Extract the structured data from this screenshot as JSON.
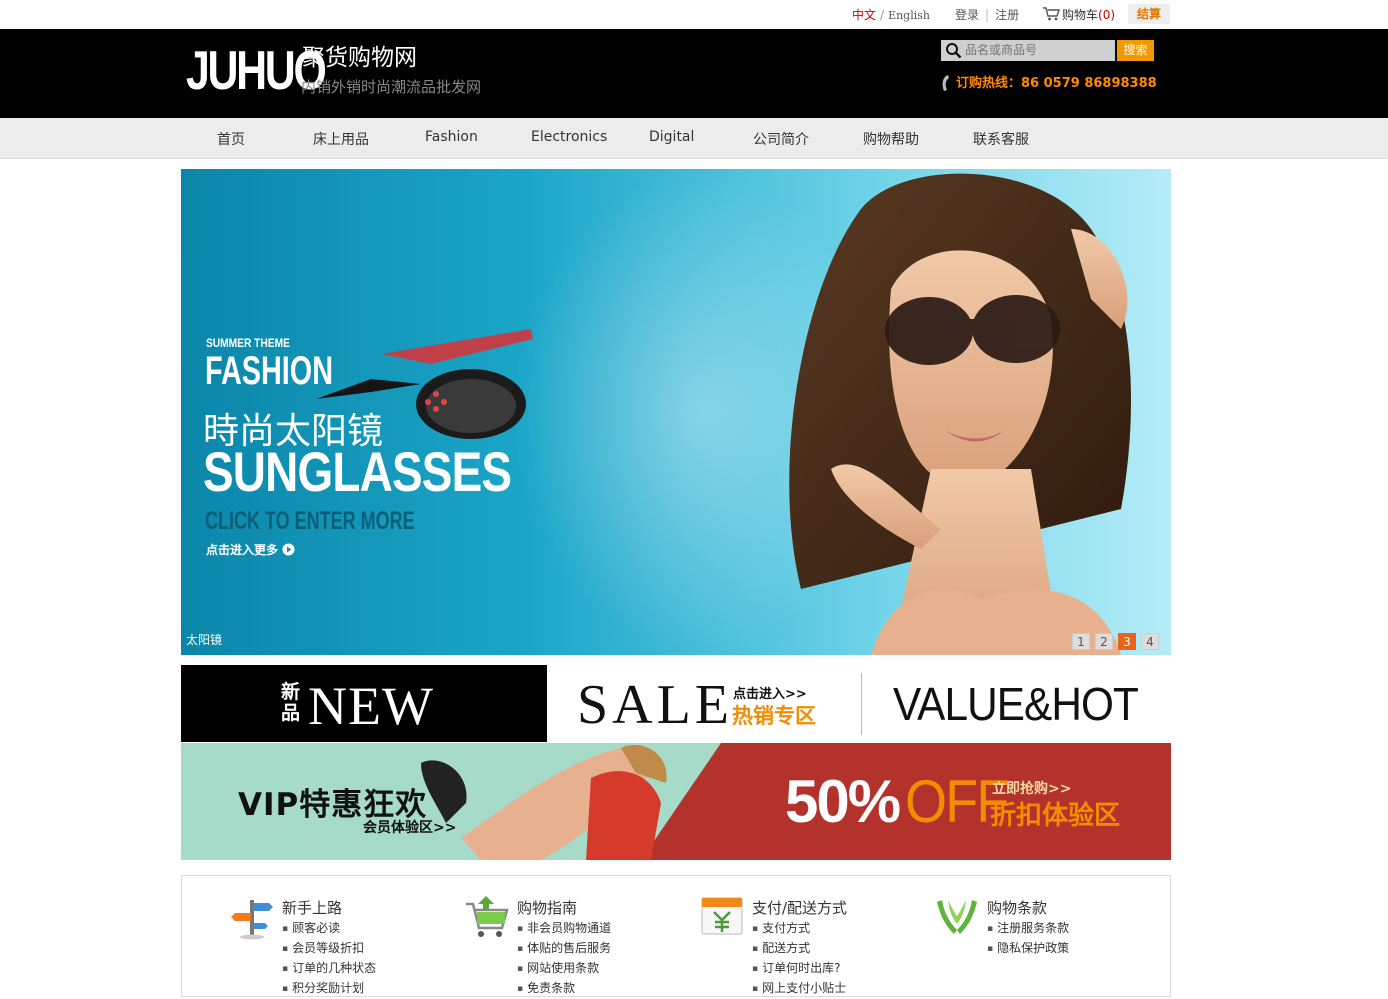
{
  "topbar": {
    "lang_cn": "中文",
    "lang_sep": "/",
    "lang_en": "English",
    "login": "登录",
    "register": "注册",
    "cart_label": "购物车",
    "cart_count": "(0)",
    "checkout": "结算"
  },
  "header": {
    "logo_main": "JUHUO",
    "logo_cn": "聚货购物网",
    "logo_sub": "内销外销时尚潮流品批发网",
    "search_placeholder": "品名或商品号",
    "search_button": "搜索",
    "hotline": "订购热线：86 0579 86898388"
  },
  "nav": {
    "items": [
      "首页",
      "床上用品",
      "Fashion",
      "Electronics",
      "Digital",
      "公司简介",
      "购物帮助",
      "联系客服"
    ]
  },
  "banner": {
    "line1": "SUMMER THEME",
    "line2": "FASHION",
    "line3": "時尚太阳镜",
    "line4": "SUNGLASSES",
    "line5": "CLICK TO ENTER MORE",
    "line6": "点击进入更多",
    "caption": "太阳镜",
    "slides": [
      "1",
      "2",
      "3",
      "4"
    ],
    "active_slide": "3"
  },
  "promo": {
    "new_cn": "新品",
    "new_en": "NEW",
    "sale": "SALE",
    "sale_enter": "点击进入>>",
    "sale_hot": "热销专区",
    "value_hot": "VALUE&HOT"
  },
  "vip": {
    "title": "VIP特惠狂欢",
    "sub": "会员体验区>>",
    "percent": "50%",
    "off": "OFF",
    "grab": "立即抢购>>",
    "zone": "折扣体验区"
  },
  "footer": {
    "columns": [
      {
        "icon": "signpost-icon",
        "title": "新手上路",
        "links": [
          "顾客必读",
          "会员等级折扣",
          "订单的几种状态",
          "积分奖励计划"
        ]
      },
      {
        "icon": "cart-icon",
        "title": "购物指南",
        "links": [
          "非会员购物通道",
          "体贴的售后服务",
          "网站使用条款",
          "免责条款"
        ]
      },
      {
        "icon": "payment-icon",
        "title": "支付/配送方式",
        "links": [
          "支付方式",
          "配送方式",
          "订单何时出库?",
          "网上支付小贴士"
        ]
      },
      {
        "icon": "hands-icon",
        "title": "购物条款",
        "links": [
          "注册服务条款",
          "隐私保护政策"
        ]
      }
    ]
  },
  "colors": {
    "accent_orange": "#f39800",
    "header_bg": "#000000",
    "nav_bg": "#ececec",
    "vip_red": "#b3322c",
    "vip_mint": "#a6dbc9"
  }
}
